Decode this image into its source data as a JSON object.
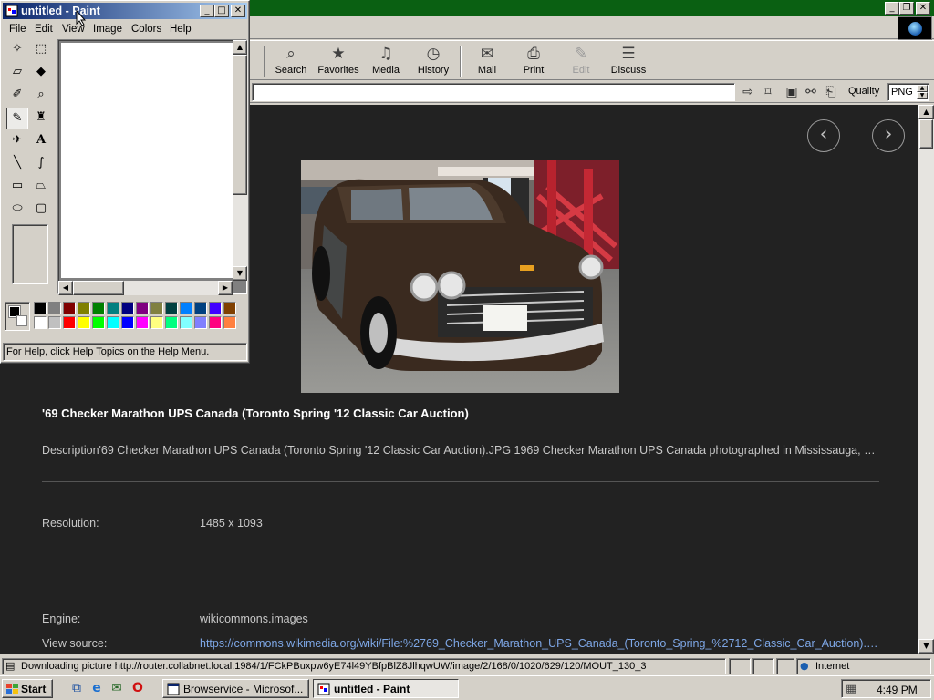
{
  "browser": {
    "toolbar": [
      {
        "label": "Search",
        "icon": "search-icon",
        "glyph": "⌕"
      },
      {
        "label": "Favorites",
        "icon": "favorites-icon",
        "glyph": "★"
      },
      {
        "label": "Media",
        "icon": "media-icon",
        "glyph": "♫"
      },
      {
        "label": "History",
        "icon": "history-icon",
        "glyph": "◷"
      },
      {
        "label": "Mail",
        "icon": "mail-icon",
        "glyph": "✉"
      },
      {
        "label": "Print",
        "icon": "print-icon",
        "glyph": "⎙"
      },
      {
        "label": "Edit",
        "icon": "edit-icon",
        "glyph": "✎"
      },
      {
        "label": "Discuss",
        "icon": "discuss-icon",
        "glyph": "☰"
      }
    ],
    "address_value": "",
    "quality_label": "Quality",
    "quality_value": "PNG",
    "content": {
      "title": "'69 Checker Marathon UPS Canada (Toronto Spring '12 Classic Car Auction)",
      "description": "Description'69 Checker Marathon UPS Canada (Toronto Spring '12 Classic Car Auction).JPG 1969 Checker Marathon UPS Canada photographed in Mississauga, Ontario, Canada",
      "resolution_label": "Resolution:",
      "resolution_value": "1485 x 1093",
      "engine_label": "Engine:",
      "engine_value": "wikicommons.images",
      "source_label": "View source:",
      "source_value": "https://commons.wikimedia.org/wiki/File:%2769_Checker_Marathon_UPS_Canada_(Toronto_Spring_%2712_Classic_Car_Auction).JPG",
      "prev_glyph": "‹",
      "next_glyph": "›"
    },
    "status_text": "Downloading picture http://router.collabnet.local:1984/1/FCkPBuxpw6yE74l49YBfpBlZ8JlhqwUW/image/2/168/0/1020/629/120/MOUT_130_3",
    "zone_text": "Internet"
  },
  "paint": {
    "title": "untitled - Paint",
    "menu": [
      "File",
      "Edit",
      "View",
      "Image",
      "Colors",
      "Help"
    ],
    "status": "For Help, click Help Topics on the Help Menu.",
    "tools": [
      {
        "name": "free-select-icon",
        "glyph": "✧"
      },
      {
        "name": "select-icon",
        "glyph": "⬚"
      },
      {
        "name": "eraser-icon",
        "glyph": "▱"
      },
      {
        "name": "fill-icon",
        "glyph": "◆"
      },
      {
        "name": "pick-color-icon",
        "glyph": "✐"
      },
      {
        "name": "magnifier-icon",
        "glyph": "⌕"
      },
      {
        "name": "pencil-icon",
        "glyph": "✎"
      },
      {
        "name": "brush-icon",
        "glyph": "♜"
      },
      {
        "name": "airbrush-icon",
        "glyph": "✈"
      },
      {
        "name": "text-icon",
        "glyph": "A"
      },
      {
        "name": "line-icon",
        "glyph": "╲"
      },
      {
        "name": "curve-icon",
        "glyph": "∫"
      },
      {
        "name": "rectangle-icon",
        "glyph": "▭"
      },
      {
        "name": "polygon-icon",
        "glyph": "⏢"
      },
      {
        "name": "ellipse-icon",
        "glyph": "⬭"
      },
      {
        "name": "rounded-rectangle-icon",
        "glyph": "▢"
      }
    ],
    "palette_top": [
      "#000000",
      "#808080",
      "#800000",
      "#808000",
      "#008000",
      "#008080",
      "#000080",
      "#800080",
      "#808040",
      "#004040",
      "#0080ff",
      "#004080",
      "#4000ff",
      "#804000"
    ],
    "palette_bottom": [
      "#ffffff",
      "#c0c0c0",
      "#ff0000",
      "#ffff00",
      "#00ff00",
      "#00ffff",
      "#0000ff",
      "#ff00ff",
      "#ffff80",
      "#00ff80",
      "#80ffff",
      "#8080ff",
      "#ff0080",
      "#ff8040"
    ],
    "foreground": "#000000",
    "background": "#ffffff"
  },
  "taskbar": {
    "start_label": "Start",
    "tasks": [
      {
        "label": "Browservice - Microsof...",
        "active": false
      },
      {
        "label": "untitled - Paint",
        "active": true
      }
    ],
    "clock": "4:49 PM"
  }
}
